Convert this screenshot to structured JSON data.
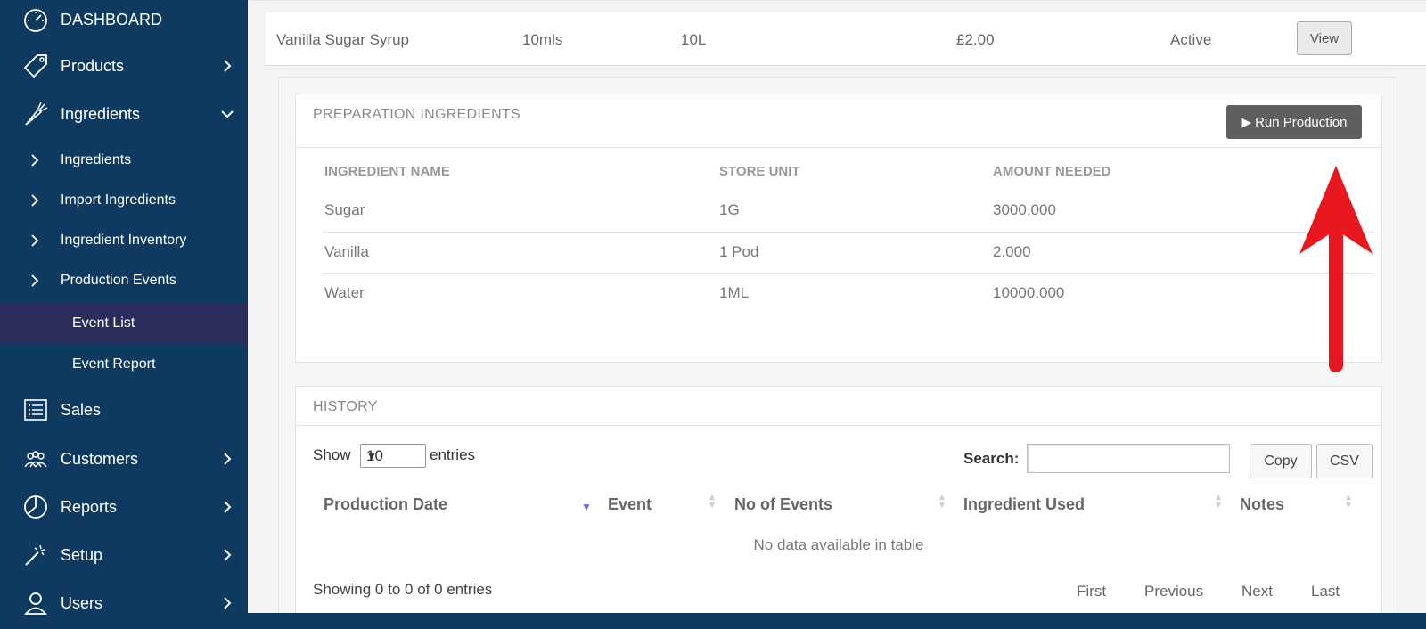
{
  "sidebar": {
    "dashboard": "DASHBOARD",
    "products": "Products",
    "ingredients": "Ingredients",
    "sub_ingredients": "Ingredients",
    "import_ingredients": "Import Ingredients",
    "ingredient_inventory": "Ingredient Inventory",
    "production_events": "Production Events",
    "event_list": "Event List",
    "event_report": "Event Report",
    "sales": "Sales",
    "customers": "Customers",
    "reports": "Reports",
    "setup": "Setup",
    "users": "Users"
  },
  "product_row": {
    "name": "Vanilla Sugar Syrup",
    "portion": "10mls",
    "volume": "10L",
    "price": "£2.00",
    "status": "Active",
    "view_label": "View"
  },
  "preparation": {
    "title": "PREPARATION INGREDIENTS",
    "run_label": "Run Production",
    "columns": [
      "INGREDIENT NAME",
      "STORE UNIT",
      "AMOUNT NEEDED"
    ],
    "rows": [
      [
        "Sugar",
        "1G",
        "3000.000"
      ],
      [
        "Vanilla",
        "1 Pod",
        "2.000"
      ],
      [
        "Water",
        "1ML",
        "10000.000"
      ]
    ]
  },
  "history": {
    "title": "HISTORY",
    "show_label": "Show",
    "entries_label": "entries",
    "page_size": "10",
    "search_label": "Search:",
    "copy_label": "Copy",
    "csv_label": "CSV",
    "columns": [
      "Production Date",
      "Event",
      "No of Events",
      "Ingredient Used",
      "Notes"
    ],
    "empty_text": "No data available in table",
    "info_text": "Showing 0 to 0 of 0 entries",
    "pager": {
      "first": "First",
      "previous": "Previous",
      "next": "Next",
      "last": "Last"
    }
  },
  "colors": {
    "sidebar_bg": "#0d3a5e",
    "sidebar_active": "#2b2d5c",
    "run_button": "#5f5f5f",
    "annotation_arrow": "#e8171f"
  }
}
